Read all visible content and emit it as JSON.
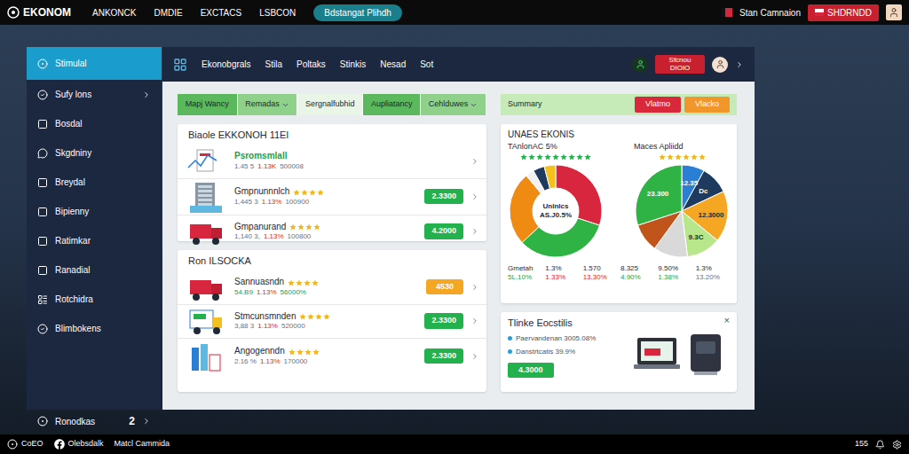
{
  "brand": {
    "name": "EKONOM"
  },
  "topnav": {
    "items": [
      "ANKONCK",
      "DMDIE",
      "EXCTACS",
      "LSBCON"
    ],
    "pill": "Bdstangat Plihdh",
    "user": "Stan Camnaion",
    "button": "SHDRNDD"
  },
  "sidebar": {
    "items": [
      {
        "label": "Stimulal",
        "selected": true,
        "chevron": false
      },
      {
        "label": "Sufy lons",
        "selected": false,
        "chevron": true
      },
      {
        "label": "Bosdal",
        "selected": false,
        "chevron": false
      },
      {
        "label": "Skgdniny",
        "selected": false,
        "chevron": false
      },
      {
        "label": "Breydal",
        "selected": false,
        "chevron": false
      },
      {
        "label": "Bipienny",
        "selected": false,
        "chevron": false
      },
      {
        "label": "Ratimkar",
        "selected": false,
        "chevron": false
      },
      {
        "label": "Ranadial",
        "selected": false,
        "chevron": false
      },
      {
        "label": "Rotchidra",
        "selected": false,
        "chevron": false
      },
      {
        "label": "Blimbokens",
        "selected": false,
        "chevron": false
      }
    ],
    "footer": {
      "label": "Ronodkas",
      "count": "2"
    }
  },
  "header": {
    "tabs": [
      "Ekonobgrals",
      "Stila",
      "Poltaks",
      "Stinkis",
      "Nesad",
      "Sot"
    ],
    "button": "Sfcnou DIOIO"
  },
  "filters": [
    {
      "label": "Mapj Wancy",
      "dropdown": false,
      "color": "#5cb85c"
    },
    {
      "label": "Remadas",
      "dropdown": true,
      "color": "#8fd18a"
    },
    {
      "label": "Sergnalfubhid",
      "dropdown": false,
      "color": "#e9f5e6"
    },
    {
      "label": "Aupliatancy",
      "dropdown": false,
      "color": "#5cb85c"
    },
    {
      "label": "Cehlduwes",
      "dropdown": true,
      "color": "#8fd18a"
    }
  ],
  "summary": {
    "title": "Summary",
    "buttons": [
      {
        "label": "Vlatmo",
        "color": "#d8283a"
      },
      {
        "label": "Vlacko",
        "color": "#f0962a"
      }
    ]
  },
  "stock_cards": [
    {
      "title": "Biaole EKKONOH 11El",
      "rows": [
        {
          "kind": "chart",
          "name": "Psromsmlall",
          "stars": 0,
          "stats": [
            {
              "text": "1.45 5",
              "color": "#6b7280"
            },
            {
              "text": "1.13K",
              "color": "#dc2626"
            },
            {
              "text": "500008",
              "color": "#6b7280"
            }
          ],
          "value": "",
          "color": "#22b14c"
        },
        {
          "kind": "stock",
          "name": "Gmpnunnnlch",
          "stars": 4,
          "stats": [
            {
              "text": "1,445 3",
              "color": "#6b7280"
            },
            {
              "text": "1.13%",
              "color": "#dc2626"
            },
            {
              "text": "100900",
              "color": "#6b7280"
            }
          ],
          "value": "2.3300",
          "color": "#22b14c"
        },
        {
          "kind": "stock",
          "name": "Gmpanurand",
          "stars": 4,
          "stats": [
            {
              "text": "1,140 3,",
              "color": "#6b7280"
            },
            {
              "text": "1.13%",
              "color": "#dc2626"
            },
            {
              "text": "100800",
              "color": "#6b7280"
            }
          ],
          "value": "4.2000",
          "color": "#22b14c"
        }
      ]
    },
    {
      "title": "Ron ILSOCKA",
      "rows": [
        {
          "kind": "stock",
          "name": "Sannuasndn",
          "stars": 4,
          "stats": [
            {
              "text": "54.B9",
              "color": "#16a34a"
            },
            {
              "text": "1.13%",
              "color": "#dc2626"
            },
            {
              "text": "56000%",
              "color": "#16a34a"
            }
          ],
          "value": "4530",
          "color": "#f5a623"
        },
        {
          "kind": "stock",
          "name": "Stmcunsmnden",
          "stars": 4,
          "stats": [
            {
              "text": "3,88 3",
              "color": "#6b7280"
            },
            {
              "text": "1.13%",
              "color": "#dc2626"
            },
            {
              "text": "520000",
              "color": "#6b7280"
            }
          ],
          "value": "2.3300",
          "color": "#22b14c"
        },
        {
          "kind": "stock",
          "name": "Angogenndn",
          "stars": 4,
          "stats": [
            {
              "text": "2.16 %",
              "color": "#6b7280"
            },
            {
              "text": "1.13%",
              "color": "#dc2626"
            },
            {
              "text": "170000",
              "color": "#6b7280"
            }
          ],
          "value": "2.3300",
          "color": "#22b14c"
        }
      ]
    }
  ],
  "ratings": {
    "title": "UNAES EKONIS",
    "charts": [
      {
        "kind": "donut",
        "subtitle": "TAnlonAC 5%",
        "stars": 9,
        "star_color": "#22b14c",
        "center": [
          "Unlnlcs",
          "AS.J0.5%"
        ],
        "segments": [
          {
            "value": 30,
            "color": "#d7263d",
            "label": ""
          },
          {
            "value": 33,
            "color": "#2fb344",
            "label": ""
          },
          {
            "value": 26,
            "color": "#ef8a12",
            "label": ""
          },
          {
            "value": 3,
            "color": "#f1f1f1",
            "label": ""
          },
          {
            "value": 4,
            "color": "#1f3a5f",
            "label": ""
          },
          {
            "value": 4,
            "color": "#f4c020",
            "label": ""
          }
        ]
      },
      {
        "kind": "pie",
        "subtitle": "Maces Apliidd",
        "stars": 6,
        "star_color": "#f4b41a",
        "center": [],
        "segments": [
          {
            "value": 8,
            "color": "#2a7fd4",
            "label": "12.35"
          },
          {
            "value": 10,
            "color": "#1f3a5f",
            "label": "Dc"
          },
          {
            "value": 18,
            "color": "#f5a623",
            "label": "12.3000"
          },
          {
            "value": 12,
            "color": "#b8e68a",
            "label": "9.3C"
          },
          {
            "value": 12,
            "color": "#d9d9d9",
            "label": ""
          },
          {
            "value": 10,
            "color": "#c1541b",
            "label": ""
          },
          {
            "value": 30,
            "color": "#2fb344",
            "label": "23.300"
          }
        ]
      }
    ],
    "stats": [
      {
        "top": "Gmetah",
        "bottom": "5L.10%",
        "color": "#16a34a"
      },
      {
        "top": "1.3%",
        "bottom": "1.33%",
        "color": "#dc2626"
      },
      {
        "top": "1.570",
        "bottom": "13.30%",
        "color": "#dc2626"
      },
      {
        "top": "8.325",
        "bottom": "4.90%",
        "color": "#16a34a"
      },
      {
        "top": "9.50%",
        "bottom": "1.38%",
        "color": "#16a34a"
      },
      {
        "top": "1.3%",
        "bottom": "13.20%",
        "color": "#6b7280"
      }
    ]
  },
  "promo": {
    "title": "Tlinke Eocstilis",
    "close": "×",
    "items": [
      "Paervandenan 3005.08%",
      "Danstrtcatis 39.9%"
    ],
    "button": "4.3000"
  },
  "status_bar": {
    "left": [
      "CoEO",
      "Olebsdalk",
      "Matcl Cammida"
    ],
    "right": "155"
  }
}
